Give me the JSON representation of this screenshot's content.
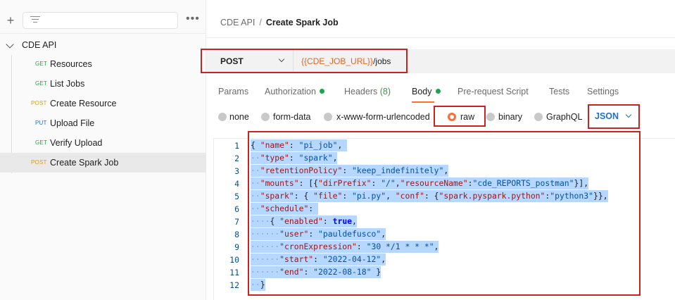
{
  "sidebar": {
    "collection": "CDE API",
    "requests": [
      {
        "method": "GET",
        "name": "Resources"
      },
      {
        "method": "GET",
        "name": "List Jobs"
      },
      {
        "method": "POST",
        "name": "Create Resource"
      },
      {
        "method": "PUT",
        "name": "Upload File"
      },
      {
        "method": "GET",
        "name": "Verify Upload"
      },
      {
        "method": "POST",
        "name": "Create Spark Job"
      }
    ]
  },
  "breadcrumb": {
    "parent": "CDE API",
    "separator": "/",
    "current": "Create Spark Job"
  },
  "request": {
    "method": "POST",
    "url_variable": "{{CDE_JOB_URL}}",
    "url_path": "/jobs"
  },
  "tabs": {
    "params": "Params",
    "authorization": "Authorization",
    "headers": "Headers",
    "headers_count": "(8)",
    "body": "Body",
    "prerequest": "Pre-request Script",
    "tests": "Tests",
    "settings": "Settings"
  },
  "body_types": {
    "none": "none",
    "form_data": "form-data",
    "urlencoded": "x-www-form-urlencoded",
    "raw": "raw",
    "binary": "binary",
    "graphql": "GraphQL",
    "format": "JSON"
  },
  "code": {
    "line_numbers": [
      "1",
      "2",
      "3",
      "4",
      "5",
      "6",
      "7",
      "8",
      "9",
      "10",
      "11",
      "12"
    ],
    "l1": {
      "open": "{ ",
      "key": "\"name\"",
      "colon": ": ",
      "val": "\"pi_job\"",
      "end": ", "
    },
    "l2": {
      "key": "\"type\"",
      "colon": ": ",
      "val": "\"spark\"",
      "end": ","
    },
    "l3": {
      "key": "\"retentionPolicy\"",
      "colon": ": ",
      "val": "\"keep_indefinitely\"",
      "end": ","
    },
    "l4": {
      "key": "\"mounts\"",
      "colon": ": [{",
      "k2": "\"dirPrefix\"",
      "c2": ": ",
      "v2": "\"/\"",
      "sep": ",",
      "k3": "\"resourceName\"",
      "c3": ":",
      "v3": "\"cde_REPORTS_postman\"",
      "end": "}],"
    },
    "l5": {
      "key": "\"spark\"",
      "colon": ": { ",
      "k2": "\"file\"",
      "c2": ": ",
      "v2": "\"pi.py\"",
      "sep": ", ",
      "k3": "\"conf\"",
      "c3": ": {",
      "k4": "\"spark.pyspark.python\"",
      "c4": ":",
      "v4": "\"python3\"",
      "end": "}},"
    },
    "l6": {
      "key": "\"schedule\"",
      "colon": ":"
    },
    "l7": {
      "open": "{ ",
      "key": "\"enabled\"",
      "colon": ": ",
      "val": "true",
      "end": ","
    },
    "l8": {
      "key": "\"user\"",
      "colon": ": ",
      "val": "\"pauldefusco\"",
      "end": ","
    },
    "l9": {
      "key": "\"cronExpression\"",
      "colon": ": ",
      "val": "\"30 */1 * * *\"",
      "end": ","
    },
    "l10": {
      "key": "\"start\"",
      "colon": ": ",
      "val": "\"2022-04-12\"",
      "end": ","
    },
    "l11": {
      "key": "\"end\"",
      "colon": ": ",
      "val": "\"2022-08-18\"",
      "end": " }"
    },
    "l12": {
      "close": "}"
    }
  },
  "colors": {
    "accent": "#ff6c37",
    "annotation": "#c8231c",
    "selection": "#b6d7ff"
  }
}
